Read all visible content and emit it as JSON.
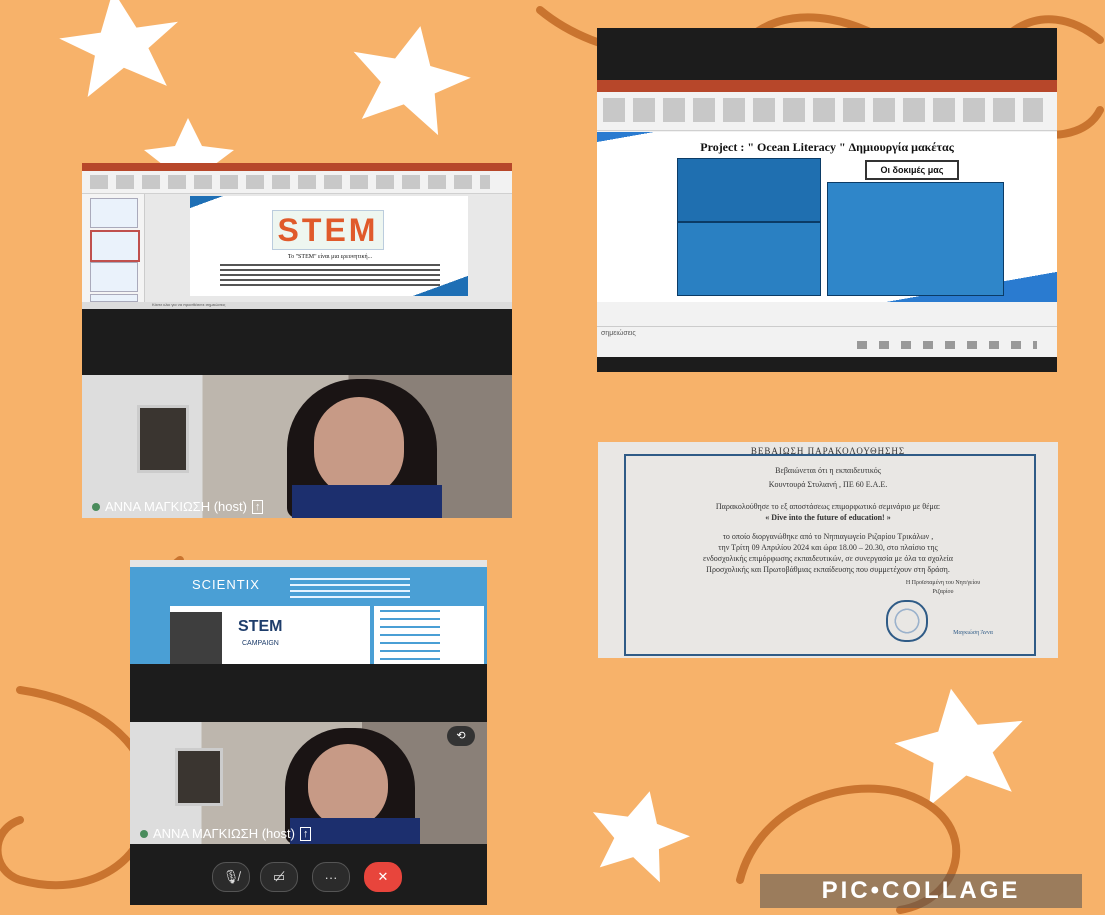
{
  "collage": {
    "watermark": "PIC•COLLAGE",
    "background": "#f7b26a",
    "accent_brown": "#c9742f"
  },
  "panel_stem": {
    "stem_logo": "STEM",
    "slide_text": "Το \"STEM\" είναι μια ερευνητική...",
    "status_bar": "Κάντε κλικ για να προσθέσετε σημειώσεις"
  },
  "panel_ocean": {
    "slide_title": "Project : \" Ocean Literacy \"  Δημιουργία μακέτας",
    "banner": "Οι δοκιμές μας",
    "status_left": "σημειώσεις"
  },
  "panel_host1": {
    "participant_label": "ΑΝΝΑ ΜΑΓΚΙΩΣΗ (host)"
  },
  "panel_cert": {
    "title": "ΒΕΒΑΙΩΣΗ ΠΑΡΑΚΟΛΟΥΘΗΣΗΣ",
    "line1": "Βεβαιώνεται ότι η  εκπαιδευτικός",
    "line2": "Κουντουρά Στυλιανή , ΠΕ 60 Ε.Α.Ε.",
    "line3": "Παρακολούθησε το εξ αποστάσεως  επιμορφωτικό σεμινάριο με θέμα:",
    "line4": "« Dive into the future of education! »",
    "line5": "το οποίο διοργανώθηκε από το Νηπιαγωγείο Ριζαρίου Τρικάλων ,",
    "line6": "την Τρίτη 09 Απριλίου 2024 και ώρα 18.00 – 20.30, στο πλαίσιο της",
    "line7": "ενδοσχολικής επιμόρφωσης εκπαιδευτικών, σε συνεργασία με όλα τα σχολεία",
    "line8": "Προσχολικής και Πρωτοβάθμιας εκπαίδευσης που συμμετέχουν στη δράση.",
    "line9": "Η Προϊσταμένη του Νηπ/γείου",
    "line10": "Ριζαρίου",
    "signature_name": "Μαγκιώση Άννα"
  },
  "panel_scientix": {
    "site_logo": "SCIENTIX",
    "hero_stem": "STEM",
    "hero_sub": "CAMPAIGN"
  },
  "panel_host2": {
    "participant_label": "ΑΝΝΑ ΜΑΓΚΙΩΣΗ (host)",
    "more_label": "···"
  }
}
